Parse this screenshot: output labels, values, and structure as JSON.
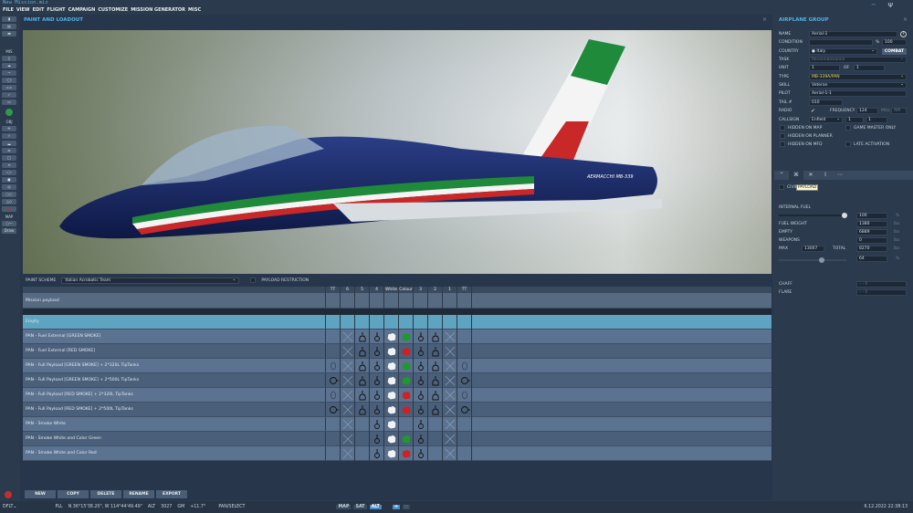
{
  "window": {
    "title": "New Mission.miz",
    "menu": [
      "FILE",
      "VIEW",
      "EDIT",
      "FLIGHT",
      "CAMPAIGN",
      "CUSTOMIZE",
      "MISSION GENERATOR",
      "MISC"
    ]
  },
  "toolbar": {
    "mis_label": "MIS",
    "obj_label": "OBJ",
    "map_label": "MAP",
    "draw_label": "Draw"
  },
  "panel": {
    "title": "PAINT AND LOADOUT",
    "paint_scheme_label": "PAINT SCHEME",
    "paint_scheme": "Italian Acrobatic Team",
    "payload_restriction": "PAYLOAD RESTRICTION",
    "aircraft_marking": "AERMACCHI MB-339"
  },
  "loadout": {
    "columns": [
      "TT",
      "6",
      "5",
      "4",
      "White",
      "Colour",
      "3",
      "2",
      "1",
      "TT"
    ],
    "mission_payload_label": "Mission payload",
    "rows": [
      {
        "label": "Empty",
        "slots": [
          "",
          "",
          "",
          "",
          "",
          "",
          "",
          "",
          "",
          ""
        ]
      },
      {
        "label": "PAN - Fuel External [GREEN SMOKE]",
        "slots": [
          "",
          "x",
          "L",
          "S",
          "W",
          "G",
          "S",
          "L",
          "x",
          ""
        ]
      },
      {
        "label": "PAN - Fuel External [RED SMOKE]",
        "slots": [
          "",
          "x",
          "L",
          "S",
          "W",
          "R",
          "S",
          "L",
          "x",
          ""
        ]
      },
      {
        "label": "PAN - Full Payload [GREEN SMOKE] + 2*320L TipTanks",
        "slots": [
          "O",
          "x",
          "L",
          "S",
          "W",
          "G",
          "S",
          "L",
          "x",
          "O"
        ]
      },
      {
        "label": "PAN - Full Payload [GREEN SMOKE] + 2*500L TipTanks",
        "slots": [
          "T",
          "x",
          "L",
          "S",
          "W",
          "G",
          "S",
          "L",
          "x",
          "T"
        ]
      },
      {
        "label": "PAN - Full Payload [RED SMOKE] + 2*320L TipTanks",
        "slots": [
          "O",
          "x",
          "L",
          "S",
          "W",
          "R",
          "S",
          "L",
          "x",
          "O"
        ]
      },
      {
        "label": "PAN - Full Payload [RED SMOKE] + 2*500L TipTanks",
        "slots": [
          "T",
          "x",
          "L",
          "S",
          "W",
          "R",
          "S",
          "L",
          "x",
          "T"
        ]
      },
      {
        "label": "PAN - Smoke White",
        "slots": [
          "",
          "x",
          "",
          "S",
          "W",
          "",
          "S",
          "",
          "x",
          ""
        ]
      },
      {
        "label": "PAN - Smoke White and Color Green",
        "slots": [
          "",
          "x",
          "",
          "S",
          "W",
          "G",
          "S",
          "",
          "x",
          ""
        ]
      },
      {
        "label": "PAN - Smoke White and Color Red",
        "slots": [
          "",
          "x",
          "",
          "S",
          "W",
          "R",
          "S",
          "",
          "x",
          ""
        ]
      }
    ],
    "selected_index": 0
  },
  "buttons": {
    "new": "NEW",
    "copy": "COPY",
    "delete": "DELETE",
    "rename": "RENAME",
    "export": "EXPORT"
  },
  "status": {
    "layer": "DFLT",
    "coord_label": "PLL",
    "coords": "N 36°15'38.20\", W 114°44'49.49\"",
    "alt_label": "ALT",
    "alt": "3027",
    "gm_label": "GM",
    "gm": "+11.7°",
    "mode": "PAN/SELECT",
    "map": "MAP",
    "sat": "SAT",
    "alt_btn": "ALT",
    "datetime": "6.12.2022 22:38:13"
  },
  "group": {
    "title": "AIRPLANE GROUP",
    "name_label": "NAME",
    "name": "Aerial-1",
    "help": "?",
    "condition_label": "CONDITION",
    "condition_unit": "%",
    "condition": "100",
    "country_label": "COUNTRY",
    "country": "Italy",
    "combat": "COMBAT",
    "task_label": "TASK",
    "task": "Reconnaissance",
    "unit_label": "UNIT",
    "unit": "1",
    "of_label": "OF",
    "unit_total": "1",
    "type_label": "TYPE",
    "type": "MB-339A/PAN",
    "skill_label": "SKILL",
    "skill": "Veteran",
    "pilot_label": "PILOT",
    "pilot": "Aerial-1-1",
    "tail_label": "TAIL #",
    "tail": "010",
    "radio_label": "RADIO",
    "frequency_label": "FREQUENCY",
    "frequency": "124",
    "freq_unit": "MHz",
    "modulation": "AM",
    "callsign_label": "CALLSIGN",
    "callsign": "Enfield",
    "callsign_n1": "1",
    "callsign_n2": "1",
    "hidden_map": "HIDDEN ON MAP",
    "game_master": "GAME MASTER ONLY",
    "hidden_planner": "HIDDEN ON PLANNER",
    "hidden_mfd": "HIDDEN ON MFD",
    "late_activation": "LATE ACTIVATION"
  },
  "payload": {
    "civil_label": "CIVIL",
    "tooltip": "PAYLOAD",
    "internal_fuel_label": "INTERNAL FUEL",
    "internal_fuel_pct": "100",
    "pct": "%",
    "fuel_weight_label": "FUEL WEIGHT",
    "fuel_weight": "1380",
    "empty_label": "EMPTY",
    "empty": "6889",
    "weapons_label": "WEAPONS",
    "weapons": "0",
    "max_label": "MAX",
    "max": "13007",
    "total_label": "TOTAL",
    "total": "8270",
    "total_pct": "64",
    "lbs": "lbs",
    "chaff_label": "CHAFF",
    "chaff": "0",
    "flare_label": "FLARE",
    "flare": "0"
  }
}
